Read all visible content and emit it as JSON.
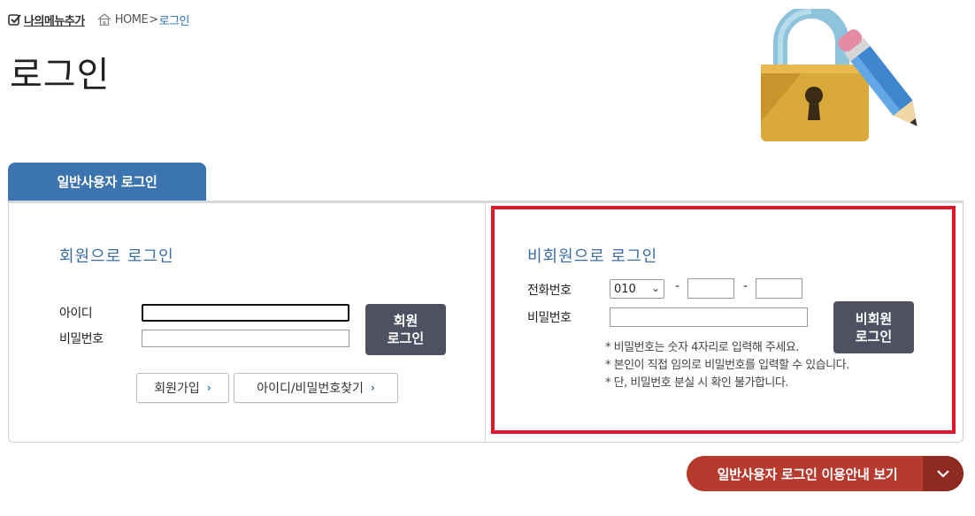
{
  "top": {
    "mymenu_label": "나의메뉴추가",
    "home_label": "HOME",
    "separator": ">",
    "current_page": "로그인"
  },
  "page_title": "로그인",
  "tab_label": "일반사용자 로그인",
  "member": {
    "title": "회원으로 로그인",
    "id_label": "아이디",
    "password_label": "비밀번호",
    "id_value": "",
    "password_value": "",
    "login_button_line1": "회원",
    "login_button_line2": "로그인",
    "signup_label": "회원가입",
    "find_label": "아이디/비밀번호찾기",
    "chevron": "›"
  },
  "nonmember": {
    "title": "비회원으로 로그인",
    "phone_label": "전화번호",
    "phone_prefix": "010",
    "dash": "-",
    "phone_mid": "",
    "phone_last": "",
    "password_label": "비밀번호",
    "password_value": "",
    "login_button_line1": "비회원",
    "login_button_line2": "로그인",
    "notes": [
      "* 비밀번호는 숫자 4자리로 입력해 주세요.",
      "* 본인이 직접 임의로 비밀번호를 입력할 수 있습니다.",
      "* 단, 비밀번호 분실 시 확인 불가합니다."
    ]
  },
  "guide_button_label": "일반사용자 로그인 이용안내 보기",
  "colors": {
    "accent_blue": "#3b74ae",
    "highlight_red": "#e3142a",
    "guide_red": "#b63a2d",
    "dark_button": "#4e5162"
  }
}
